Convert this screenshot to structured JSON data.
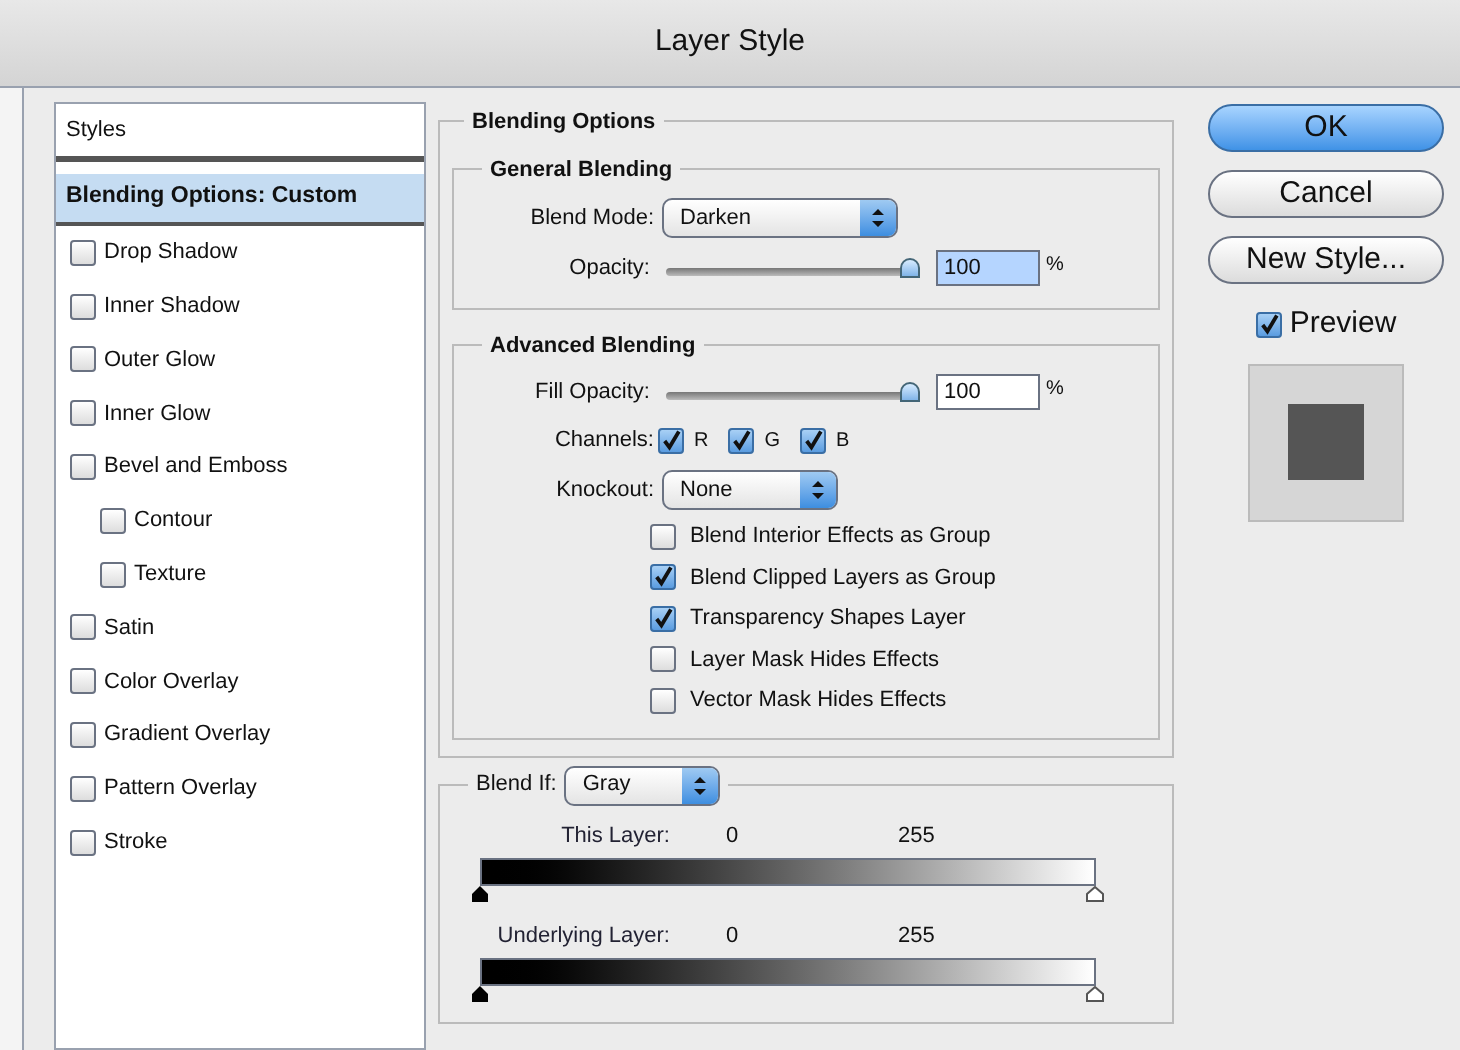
{
  "window": {
    "title": "Layer Style"
  },
  "styles_panel": {
    "header": "Styles",
    "items": [
      {
        "label": "Blending Options: Custom",
        "kind": "heading",
        "selected": true
      },
      {
        "label": "Drop Shadow",
        "kind": "checkbox",
        "checked": false,
        "selected": false
      },
      {
        "label": "Inner Shadow",
        "kind": "checkbox",
        "checked": false,
        "selected": false
      },
      {
        "label": "Outer Glow",
        "kind": "checkbox",
        "checked": false,
        "selected": false
      },
      {
        "label": "Inner Glow",
        "kind": "checkbox",
        "checked": false,
        "selected": false
      },
      {
        "label": "Bevel and Emboss",
        "kind": "checkbox",
        "checked": false,
        "selected": false,
        "children": [
          {
            "label": "Contour",
            "kind": "checkbox",
            "checked": false,
            "selected": false
          },
          {
            "label": "Texture",
            "kind": "checkbox",
            "checked": false,
            "selected": false
          }
        ]
      },
      {
        "label": "Satin",
        "kind": "checkbox",
        "checked": false,
        "selected": false
      },
      {
        "label": "Color Overlay",
        "kind": "checkbox",
        "checked": false,
        "selected": false
      },
      {
        "label": "Gradient Overlay",
        "kind": "checkbox",
        "checked": false,
        "selected": false
      },
      {
        "label": "Pattern Overlay",
        "kind": "checkbox",
        "checked": false,
        "selected": false
      },
      {
        "label": "Stroke",
        "kind": "checkbox",
        "checked": false,
        "selected": false
      }
    ]
  },
  "blending_options": {
    "title": "Blending Options",
    "general_blending": {
      "title": "General Blending",
      "blend_mode": {
        "label": "Blend Mode:",
        "value": "Darken"
      },
      "opacity": {
        "label": "Opacity:",
        "level": 1,
        "value": "100",
        "unit": "%",
        "text_selected": true
      }
    },
    "advanced_blending": {
      "title": "Advanced Blending",
      "fill_opacity": {
        "label": "Fill Opacity:",
        "level": 1,
        "value": "100",
        "unit": "%",
        "text_selected": false
      },
      "channels": {
        "label": "Channels:",
        "items": [
          {
            "label": "R",
            "checked": true
          },
          {
            "label": "G",
            "checked": true
          },
          {
            "label": "B",
            "checked": true
          }
        ]
      },
      "knockout": {
        "label": "Knockout:",
        "value": "None"
      },
      "options": [
        {
          "label": "Blend Interior Effects as Group",
          "checked": false
        },
        {
          "label": "Blend Clipped Layers as Group",
          "checked": true
        },
        {
          "label": "Transparency Shapes Layer",
          "checked": true
        },
        {
          "label": "Layer Mask Hides Effects",
          "checked": false
        },
        {
          "label": "Vector Mask Hides Effects",
          "checked": false
        }
      ]
    }
  },
  "blend_if": {
    "label": "Blend If:",
    "value": "Gray",
    "sliders": [
      {
        "label": "This Layer:",
        "min": "0",
        "max": "255"
      },
      {
        "label": "Underlying Layer:",
        "min": "0",
        "max": "255"
      }
    ]
  },
  "buttons": [
    {
      "label": "OK",
      "kind": "default"
    },
    {
      "label": "Cancel",
      "kind": "normal"
    },
    {
      "label": "New Style...",
      "kind": "normal"
    }
  ],
  "preview": {
    "label": "Preview",
    "checked": true
  }
}
